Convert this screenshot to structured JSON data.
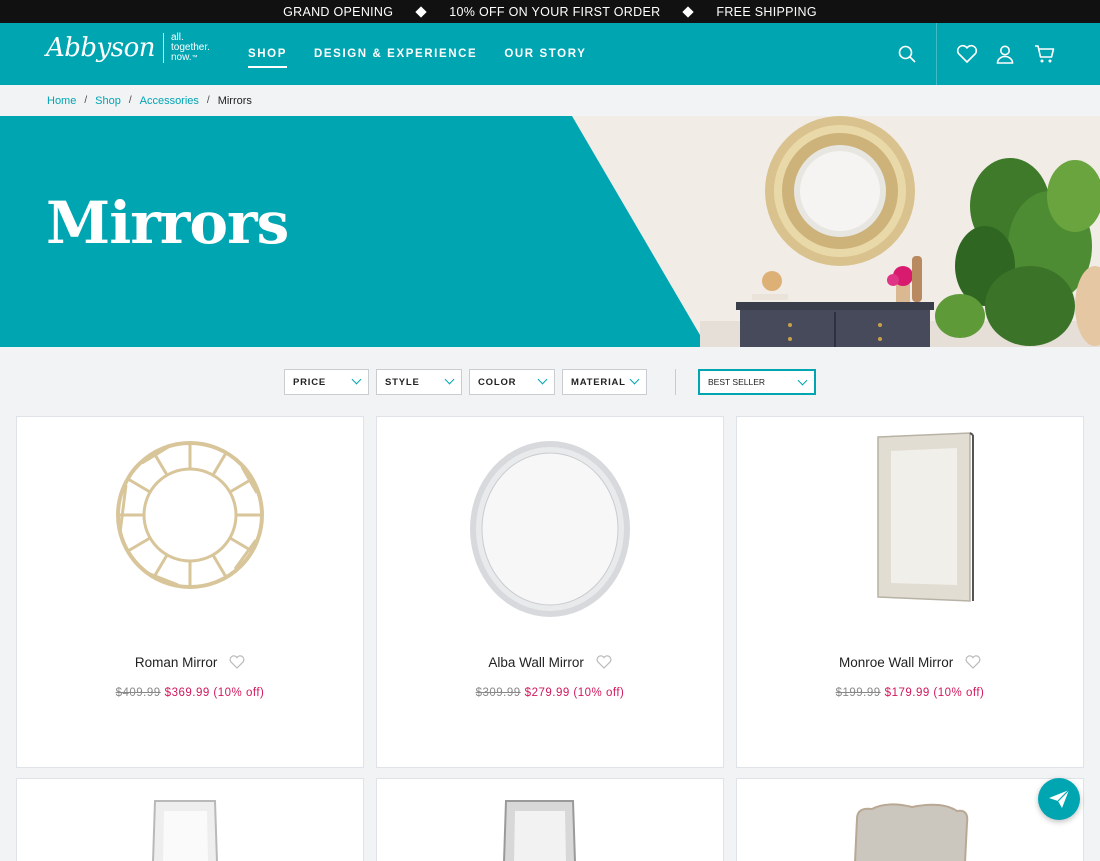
{
  "promo": {
    "items": [
      "GRAND OPENING",
      "10% OFF ON YOUR FIRST ORDER",
      "FREE SHIPPING"
    ]
  },
  "brand": {
    "name": "Abbyson",
    "tagline_1": "all.",
    "tagline_2": "together.",
    "tagline_3": "now.",
    "tm": "™"
  },
  "nav": {
    "items": [
      {
        "label": "SHOP",
        "active": true
      },
      {
        "label": "DESIGN & EXPERIENCE",
        "active": false
      },
      {
        "label": "OUR STORY",
        "active": false
      }
    ]
  },
  "header_icons": [
    "search-icon",
    "heart-icon",
    "user-icon",
    "cart-icon"
  ],
  "breadcrumb": {
    "items": [
      "Home",
      "Shop",
      "Accessories",
      "Mirrors"
    ],
    "separator": "/"
  },
  "hero": {
    "title": "Mirrors"
  },
  "filters": {
    "items": [
      "PRICE",
      "STYLE",
      "COLOR",
      "MATERIAL"
    ],
    "sort_selected": "BEST SELLER"
  },
  "products": [
    {
      "name": "Roman Mirror",
      "old_price": "$409.99",
      "new_price": "$369.99 (10% off)"
    },
    {
      "name": "Alba Wall Mirror",
      "old_price": "$309.99",
      "new_price": "$279.99 (10% off)"
    },
    {
      "name": "Monroe Wall Mirror",
      "old_price": "$199.99",
      "new_price": "$179.99 (10% off)"
    }
  ],
  "colors": {
    "brand_teal": "#00a5b2",
    "sale_red": "#d0185b",
    "promo_bg": "#111111"
  }
}
